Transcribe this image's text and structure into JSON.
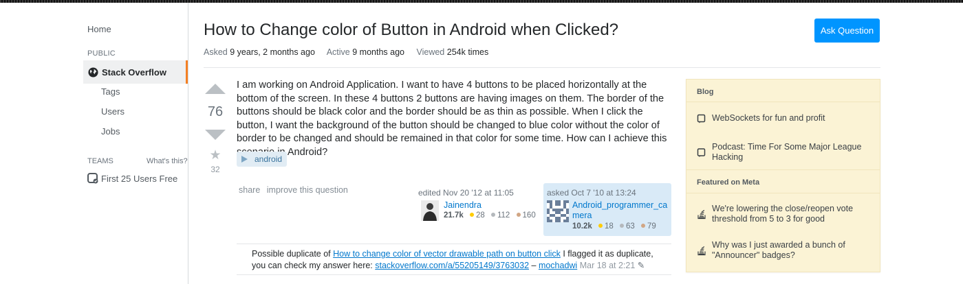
{
  "nav": {
    "home": "Home",
    "public_heading": "PUBLIC",
    "stack_overflow": "Stack Overflow",
    "tags": "Tags",
    "users": "Users",
    "jobs": "Jobs",
    "teams_heading": "TEAMS",
    "whats_this": "What's this?",
    "first_users": "First 25 Users Free"
  },
  "question": {
    "title": "How to Change color of Button in Android when Clicked?",
    "ask_button": "Ask Question",
    "asked_label": "Asked",
    "asked_value": "9 years, 2 months ago",
    "active_label": "Active",
    "active_value": "9 months ago",
    "viewed_label": "Viewed",
    "viewed_value": "254k times",
    "votes": "76",
    "favorites": "32",
    "body": "I am working on Android Application. I want to have 4 buttons to be placed horizontally at the bottom of the screen. In these 4 buttons 2 buttons are having images on them. The border of the buttons should be black color and the border should be as thin as possible. When I click the button, I want the background of the button should be changed to blue color without the color of border to be changed and should be remained in that color for some time. How can I achieve this scenario in Android?",
    "tag": "android",
    "share": "share",
    "improve": "improve this question"
  },
  "editor": {
    "edited": "edited Nov 20 '12 at 11:05",
    "name": "Jainendra",
    "rep": "21.7k",
    "gold": "28",
    "silver": "112",
    "bronze": "160"
  },
  "asker": {
    "asked": "asked Oct 7 '10 at 13:24",
    "name": "Android_programmer_camera",
    "rep": "10.2k",
    "gold": "18",
    "silver": "63",
    "bronze": "79"
  },
  "comment": {
    "prefix": "Possible duplicate of ",
    "link1": "How to change color of vector drawable path on button click",
    "middle": " I flagged it as duplicate, you can check my answer here: ",
    "link2": "stackoverflow.com/a/55205149/3763032",
    "dash": " – ",
    "author": "mochadwi",
    "time": "Mar 18 at 2:21"
  },
  "sidebar": {
    "blog_heading": "Blog",
    "blog_items": [
      "WebSockets for fun and profit",
      "Podcast: Time For Some Major League Hacking"
    ],
    "meta_heading": "Featured on Meta",
    "meta_items": [
      "We're lowering the close/reopen vote threshold from 5 to 3 for good",
      "Why was I just awarded a bunch of \"Announcer\" badges?"
    ]
  },
  "colors": {
    "accent": "#0095ff",
    "link": "#0077cc",
    "tag_bg": "#e1ecf4",
    "sidebar_bg": "#fbf3d5",
    "nav_highlight": "#f48024"
  }
}
